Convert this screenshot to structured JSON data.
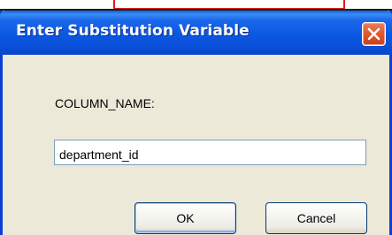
{
  "dialog": {
    "title": "Enter Substitution Variable",
    "prompt_label": "COLUMN_NAME:",
    "input_value": "department_id",
    "ok_label": "OK",
    "cancel_label": "Cancel",
    "close_icon": "close-icon"
  },
  "colors": {
    "title_bar": "#0c57e1",
    "window_border": "#0a3fd6",
    "client_background": "#ece9d8",
    "close_button": "#e25a2f",
    "input_border": "#7f9db9",
    "button_border": "#003c74",
    "background_outline": "#e01b1b"
  }
}
